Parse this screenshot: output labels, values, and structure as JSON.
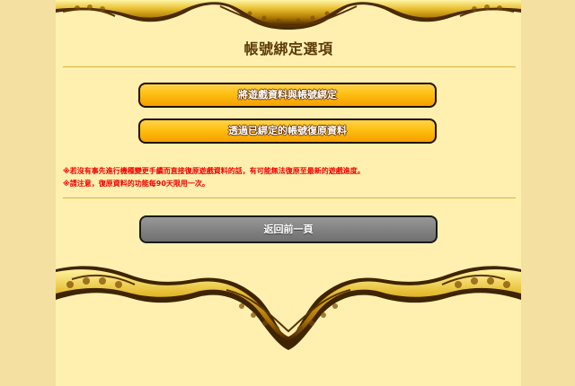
{
  "page_title": "帳號綁定選項",
  "buttons": {
    "bind_game_data": "將遊戲資料與帳號綁定",
    "restore_from_bound_account": "透過已綁定的帳號復原資料",
    "back": "返回前一頁"
  },
  "notes": [
    "※若沒有事先進行機種變更手續而直接復原遊戲資料的話，有可能無法復原至最新的遊戲進度。",
    "※請注意，復原資料的功能每90天限用一次。"
  ]
}
